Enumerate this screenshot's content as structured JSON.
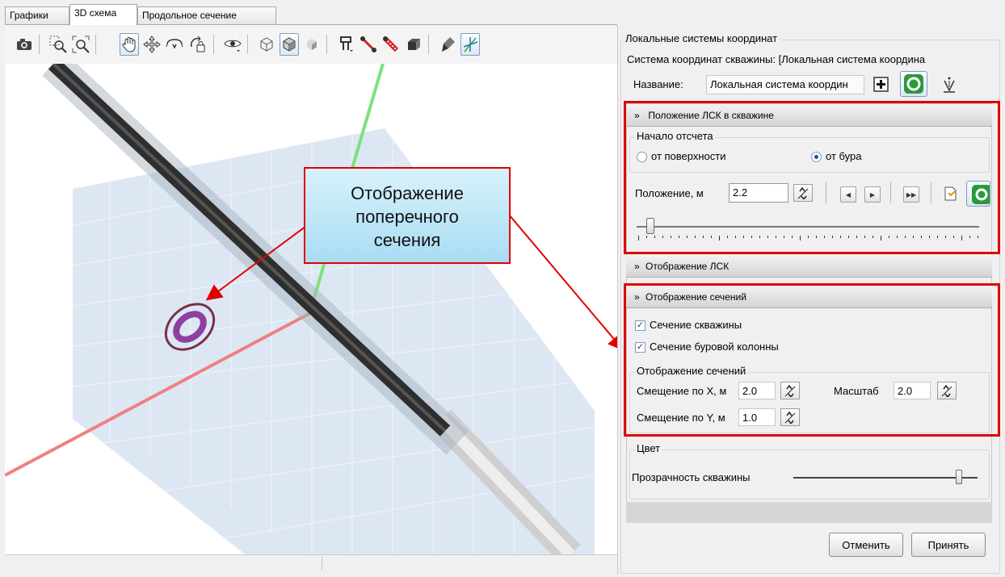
{
  "tabs": [
    {
      "label": "Графики",
      "active": false
    },
    {
      "label": "3D схема",
      "active": true
    },
    {
      "label": "Продольное сечение",
      "active": false
    }
  ],
  "toolbar": {
    "icons": [
      "camera-icon",
      "zoom-window-icon",
      "zoom-fit-icon",
      "pan-hand-icon",
      "move-icon",
      "rotate-icon",
      "rotate-lock-icon",
      "view-eye-icon",
      "cube-wire-icon",
      "cube-shaded-icon",
      "cube-solid-icon",
      "well-schematic-icon",
      "red-tool-icon",
      "striped-tool-icon",
      "box-icon",
      "drill-icon",
      "axes-icon"
    ]
  },
  "viewport": {
    "callout_text_1": "Отображение",
    "callout_text_2": "поперечного",
    "callout_text_3": "сечения"
  },
  "panel": {
    "group_title": "Локальные системы координат",
    "system_label": "Система координат скважины: [Локальная система координа",
    "name_label": "Название:",
    "name_value": "Локальная система координ",
    "position_section": {
      "header": "Положение ЛСК в скважине",
      "origin_group": "Начало отсчета",
      "radio_surface": "от поверхности",
      "radio_bit": "от бура",
      "selected": "от бура",
      "position_label": "Положение, м",
      "position_value": "2.2",
      "slider_value": 0.04
    },
    "lsk_display_header": "Отображение ЛСК",
    "sections_display": {
      "header": "Отображение сечений",
      "check_well": "Сечение скважины",
      "check_drill": "Сечение буровой колонны",
      "check_well_checked": true,
      "check_drill_checked": true,
      "sub_group": "Отображение сечений",
      "offset_x_label": "Смещение по X, м",
      "offset_x_value": "2.0",
      "offset_y_label": "Смещение по Y, м",
      "offset_y_value": "1.0",
      "scale_label": "Масштаб",
      "scale_value": "2.0"
    },
    "color_group": {
      "title": "Цвет",
      "transparency_label": "Прозрачность скважины",
      "transparency_value": 0.9
    },
    "cancel_label": "Отменить",
    "accept_label": "Принять"
  },
  "colors": {
    "highlight_red": "#e00000",
    "callout_blue": "#a8dcf2",
    "axis_green": "#7ee07e",
    "axis_red": "#f08080",
    "section_purple": "#8e3fa0"
  }
}
